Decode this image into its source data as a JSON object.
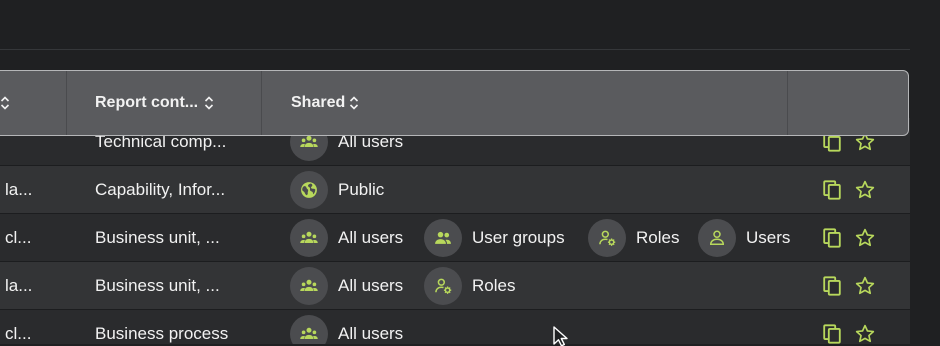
{
  "colors": {
    "accent": "#b8d85c",
    "header_bg": "#5a5b5e",
    "row_dark": "#2a2b2d",
    "row_light": "#333436"
  },
  "header": {
    "col_report_content": "Report cont...",
    "col_shared": "Shared"
  },
  "rows": [
    {
      "col1": "",
      "content": "Technical comp...",
      "shared": [
        {
          "icon": "all-users-icon",
          "label": "All users"
        }
      ]
    },
    {
      "col1": "la...",
      "content": "Capability, Infor...",
      "shared": [
        {
          "icon": "globe-icon",
          "label": "Public"
        }
      ]
    },
    {
      "col1": "cl...",
      "content": "Business unit, ...",
      "shared": [
        {
          "icon": "all-users-icon",
          "label": "All users"
        },
        {
          "icon": "user-groups-icon",
          "label": "User groups"
        },
        {
          "icon": "roles-icon",
          "label": "Roles"
        },
        {
          "icon": "user-icon",
          "label": "Users"
        }
      ]
    },
    {
      "col1": "la...",
      "content": "Business unit, ...",
      "shared": [
        {
          "icon": "all-users-icon",
          "label": "All users"
        },
        {
          "icon": "roles-icon",
          "label": "Roles"
        }
      ]
    },
    {
      "col1": "cl...",
      "content": "Business process",
      "shared": [
        {
          "icon": "all-users-icon",
          "label": "All users"
        }
      ]
    }
  ]
}
